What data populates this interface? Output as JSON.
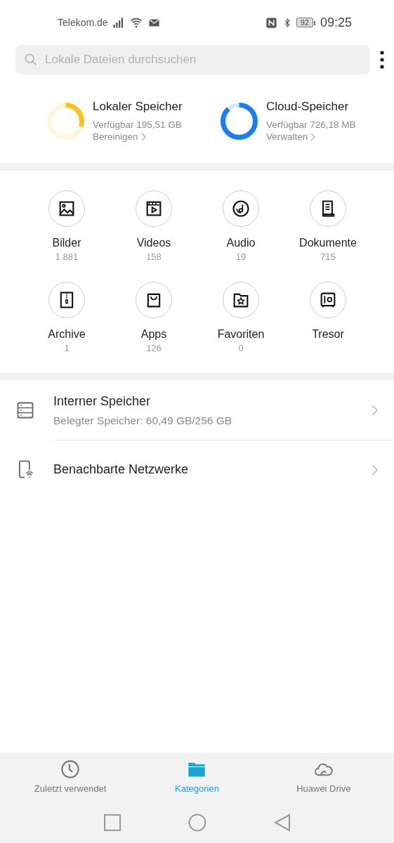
{
  "status_bar": {
    "carrier": "Telekom.de",
    "battery": "92",
    "time": "09:25"
  },
  "search": {
    "placeholder": "Lokale Dateien durchsuchen"
  },
  "storage": [
    {
      "title": "Lokaler Speicher",
      "available": "Verfügbar 195,51 GB",
      "action": "Bereinigen",
      "level": 0.3,
      "color": "#f7c21a"
    },
    {
      "title": "Cloud-Speicher",
      "available": "Verfügbar 726,18 MB",
      "action": "Verwalten",
      "level": 0.88,
      "color": "#1a7fe8"
    }
  ],
  "categories": [
    {
      "kind": "image",
      "label": "Bilder",
      "count": "1.881"
    },
    {
      "kind": "video",
      "label": "Videos",
      "count": "158"
    },
    {
      "kind": "audio",
      "label": "Audio",
      "count": "19"
    },
    {
      "kind": "document",
      "label": "Dokumente",
      "count": "715"
    },
    {
      "kind": "archive",
      "label": "Archive",
      "count": "1"
    },
    {
      "kind": "apps",
      "label": "Apps",
      "count": "126"
    },
    {
      "kind": "favorites",
      "label": "Favoriten",
      "count": "0"
    },
    {
      "kind": "vault",
      "label": "Tresor"
    }
  ],
  "locations": [
    {
      "kind": "internal",
      "title": "Interner Speicher",
      "subtitle": "Belegter Speicher: 60,49 GB/256 GB"
    },
    {
      "kind": "network",
      "title": "Benachbarte Netzwerke"
    }
  ],
  "tabs": [
    {
      "kind": "recent",
      "label": "Zuletzt verwendet",
      "selected": false
    },
    {
      "kind": "categories",
      "label": "Kategorien",
      "selected": true
    },
    {
      "kind": "cloud",
      "label": "Huawei Drive",
      "selected": false
    }
  ]
}
